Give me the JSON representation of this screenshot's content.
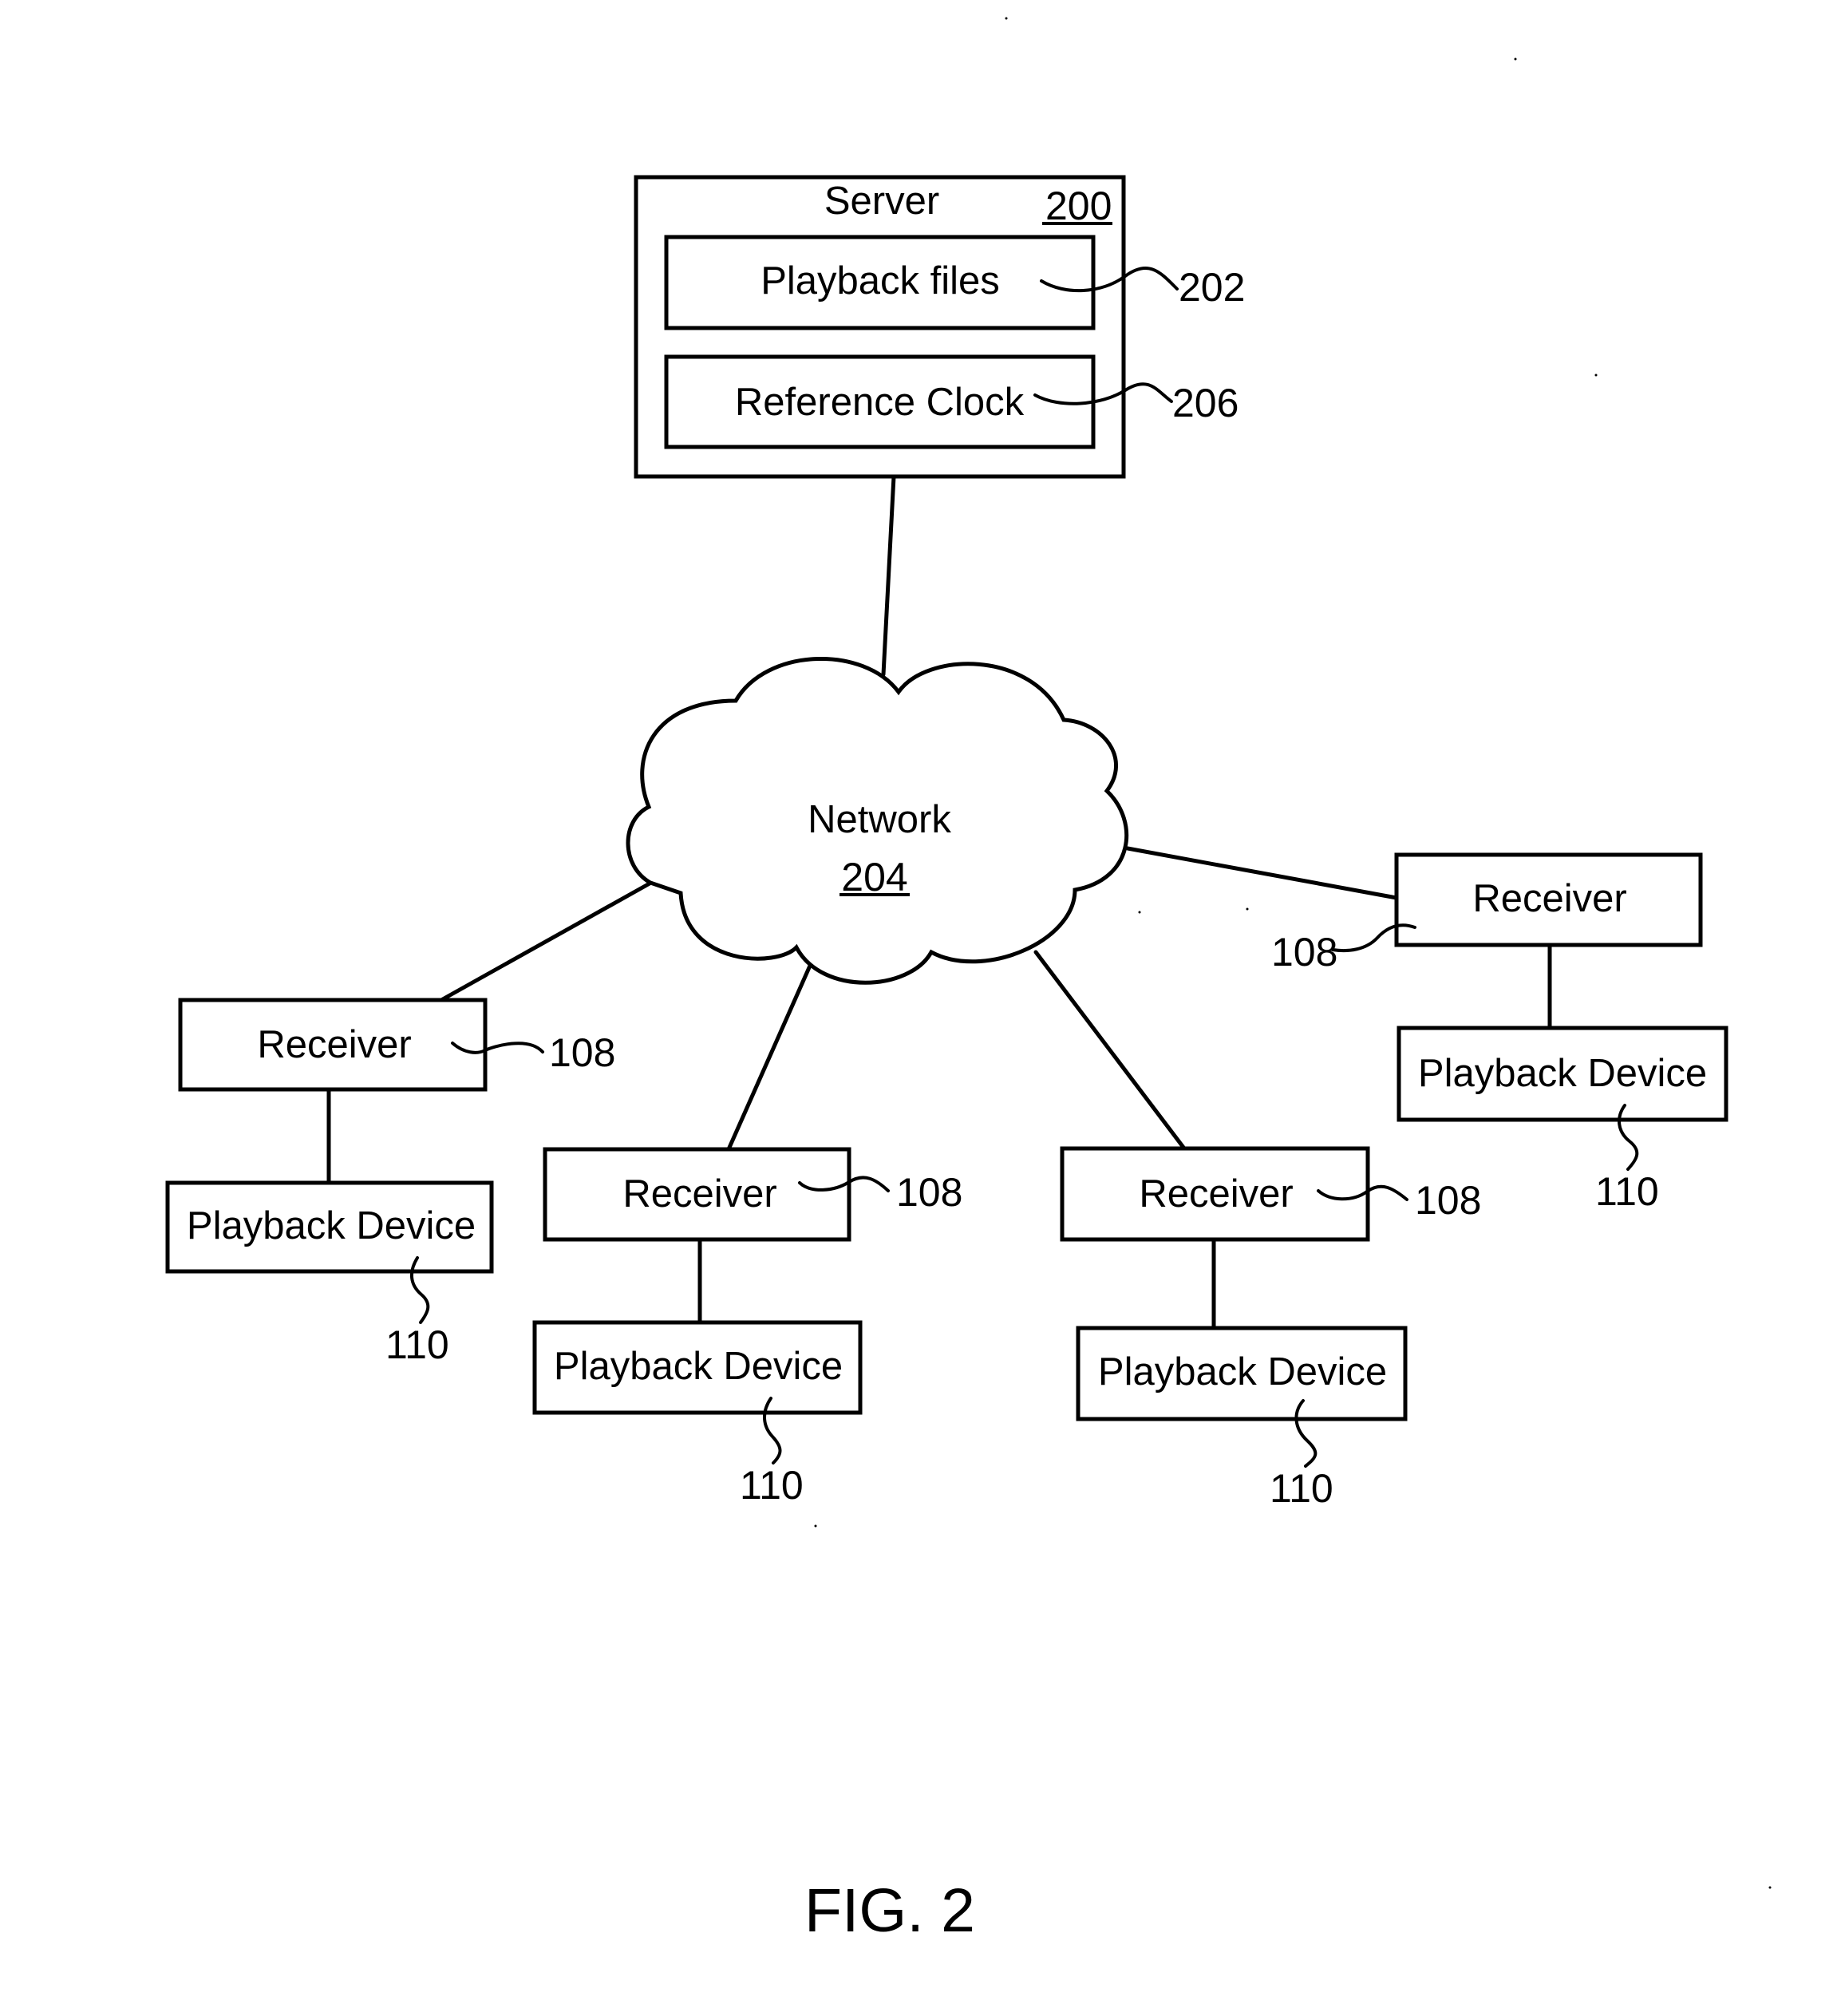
{
  "figure": {
    "label": "FIG. 2"
  },
  "server": {
    "title": "Server",
    "ref": "200",
    "components": [
      {
        "label": "Playback files",
        "ref": "202"
      },
      {
        "label": "Reference Clock",
        "ref": "206"
      }
    ]
  },
  "network": {
    "label": "Network",
    "ref": "204"
  },
  "groups": [
    {
      "receiver": "Receiver",
      "receiver_ref": "108",
      "device": "Playback Device",
      "device_ref": "110"
    },
    {
      "receiver": "Receiver",
      "receiver_ref": "108",
      "device": "Playback Device",
      "device_ref": "110"
    },
    {
      "receiver": "Receiver",
      "receiver_ref": "108",
      "device": "Playback Device",
      "device_ref": "110"
    },
    {
      "receiver": "Receiver",
      "receiver_ref": "108",
      "device": "Playback Device",
      "device_ref": "110"
    }
  ]
}
